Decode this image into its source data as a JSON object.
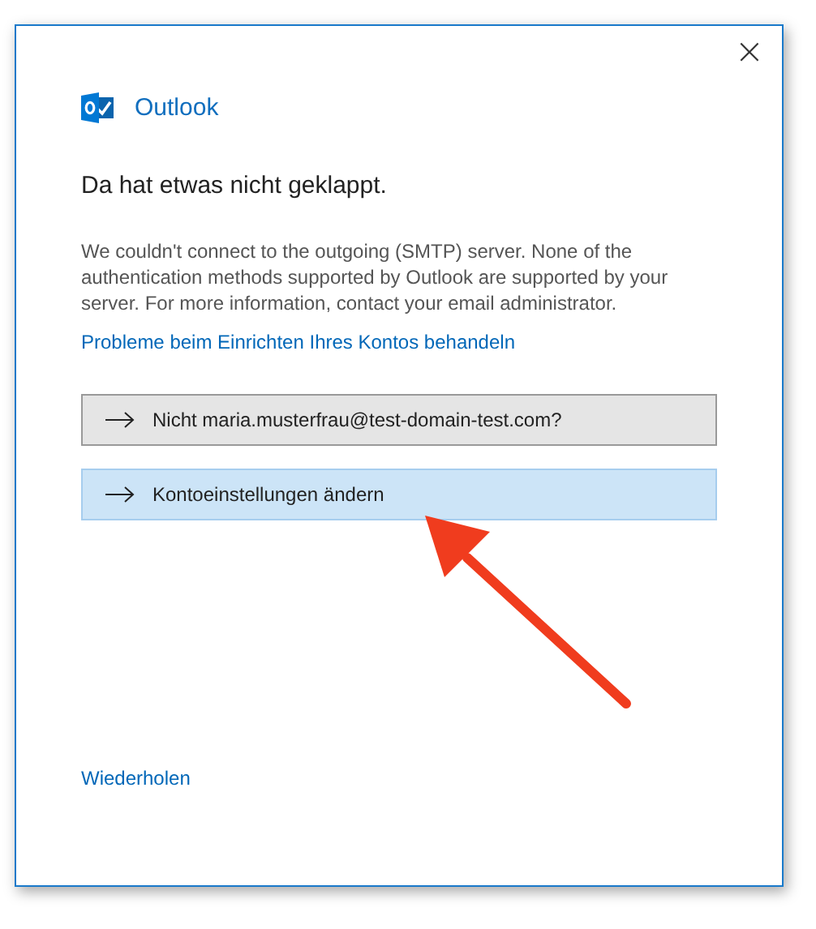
{
  "window": {
    "close": "×"
  },
  "brand": {
    "name": "Outlook"
  },
  "heading": "Da hat etwas nicht geklappt.",
  "message": "We couldn't connect to the outgoing (SMTP) server. None of the authentication methods supported by Outlook are supported by your server. For more information, contact your email administrator.",
  "help_link": "Probleme beim Einrichten Ihres Kontos behandeln",
  "options": [
    {
      "label": "Nicht maria.musterfrau@test-domain-test.com?",
      "selected": false
    },
    {
      "label": "Kontoeinstellungen ändern",
      "selected": true
    }
  ],
  "retry_link": "Wiederholen",
  "annotation": {
    "kind": "arrow"
  }
}
